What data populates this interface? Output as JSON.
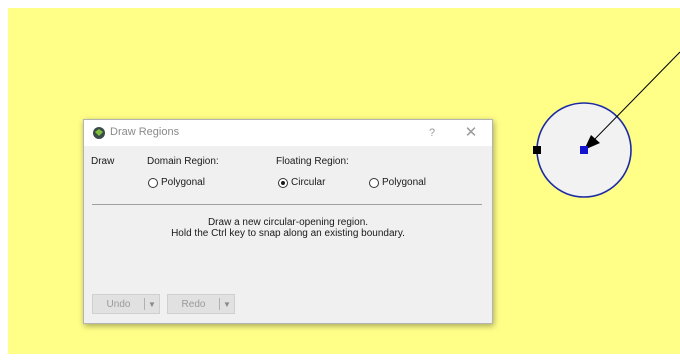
{
  "canvas": {
    "background": "#ffff88"
  },
  "dialog": {
    "title": "Draw Regions",
    "help_label": "?",
    "close_label": "✕",
    "draw_label": "Draw",
    "domain_region_label": "Domain Region:",
    "floating_region_label": "Floating Region:",
    "domain_options": [
      {
        "label": "Polygonal",
        "selected": false
      }
    ],
    "floating_options": [
      {
        "label": "Circular",
        "selected": true
      },
      {
        "label": "Polygonal",
        "selected": false
      }
    ],
    "message_line1": "Draw a new circular-opening region.",
    "message_line2": "Hold the Ctrl key to snap along an existing boundary.",
    "undo_label": "Undo",
    "redo_label": "Redo"
  },
  "colors": {
    "circle_stroke": "#1c2ba3",
    "circle_fill": "#f2f2f2",
    "center_handle": "#1414d0",
    "edge_handle": "#000000"
  }
}
